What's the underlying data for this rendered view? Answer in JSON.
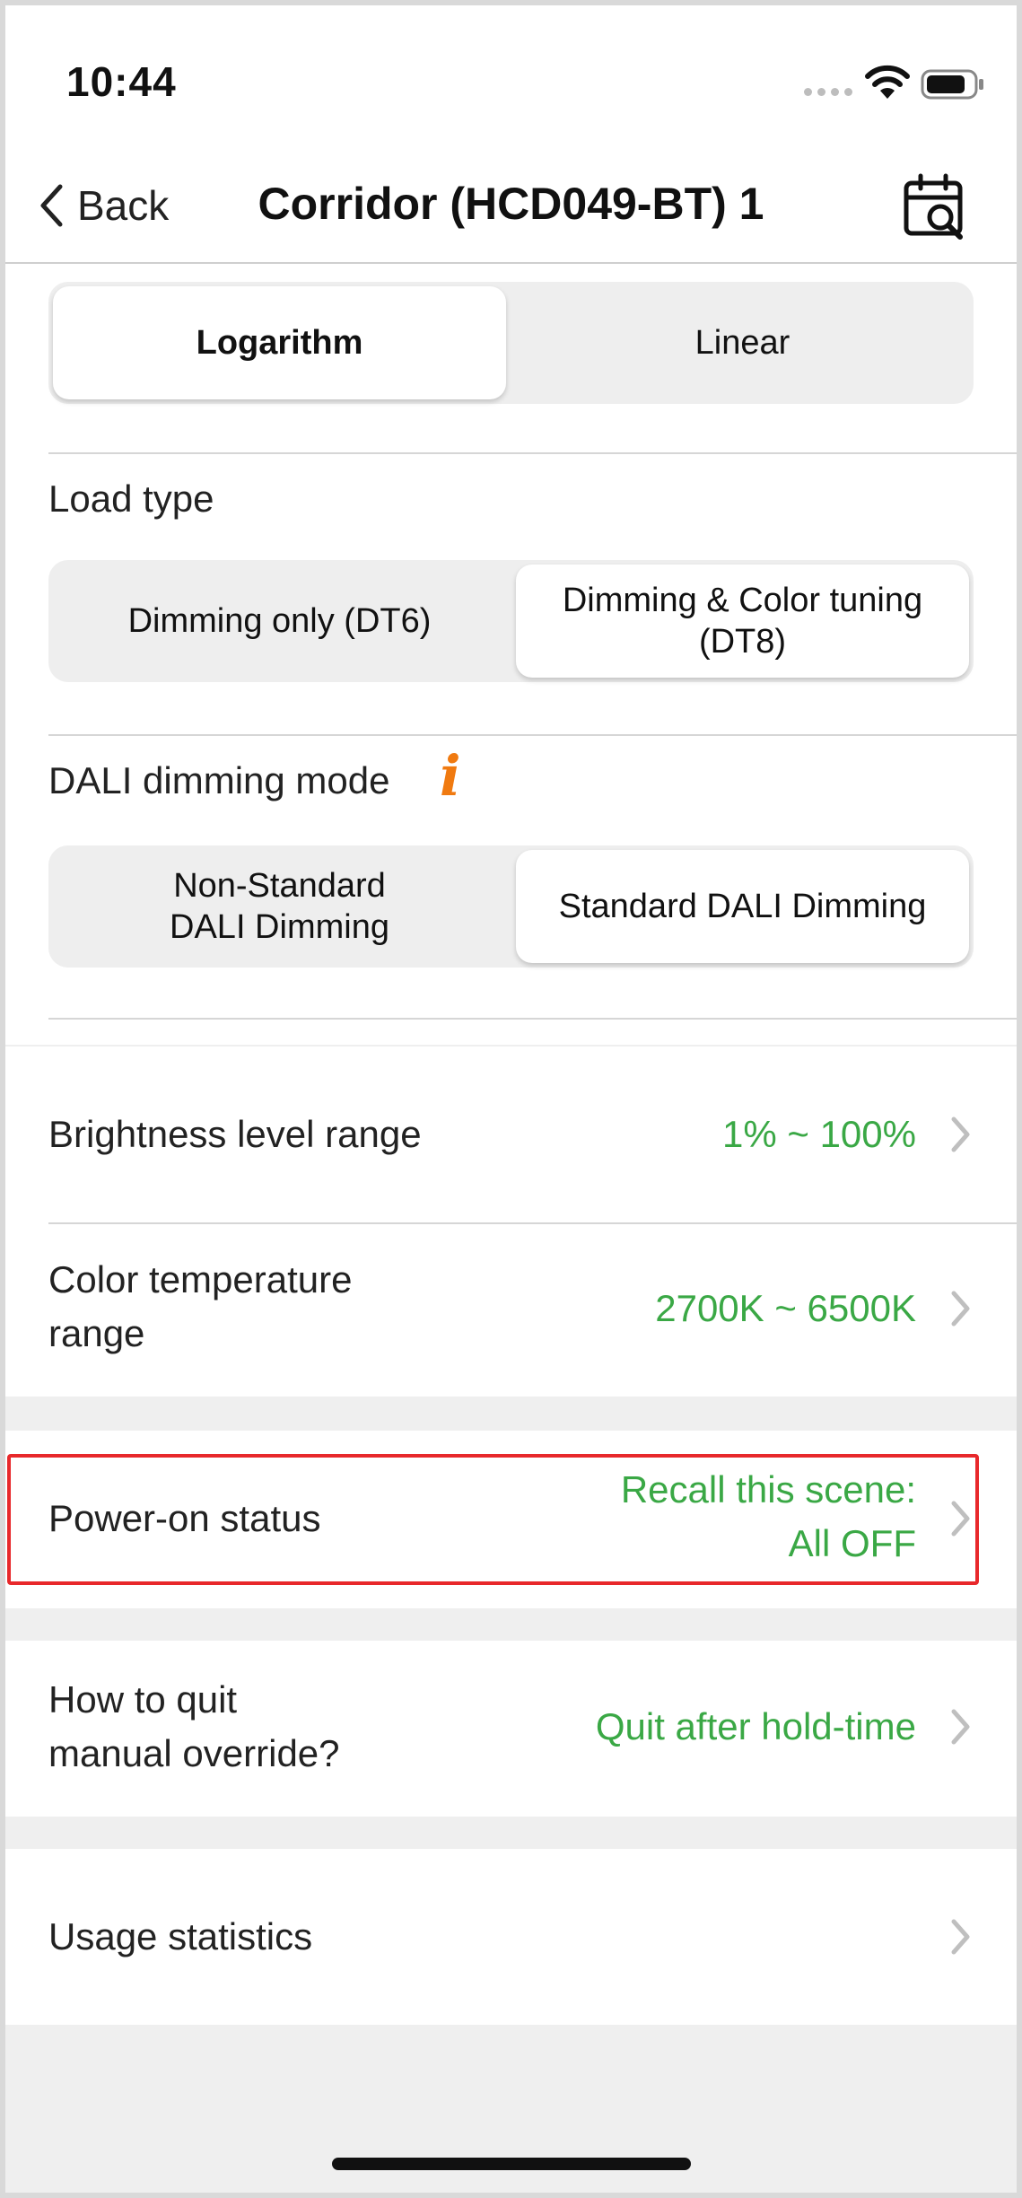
{
  "status": {
    "time": "10:44"
  },
  "nav": {
    "back": "Back",
    "title": "Corridor (HCD049-BT) 1"
  },
  "curve": {
    "options": [
      "Logarithm",
      "Linear"
    ],
    "selected": "Logarithm"
  },
  "load_type": {
    "label": "Load type",
    "options": [
      "Dimming only (DT6)",
      "Dimming & Color tuning\n(DT8)"
    ],
    "selected": "Dimming & Color tuning (DT8)"
  },
  "dali_mode": {
    "label": "DALI dimming mode",
    "info_glyph": "i",
    "options": [
      "Non-Standard\nDALI Dimming",
      "Standard DALI Dimming"
    ],
    "selected": "Standard DALI Dimming"
  },
  "settings": {
    "brightness": {
      "label": "Brightness level range",
      "value": "1% ~ 100%"
    },
    "color_temp": {
      "label": "Color temperature\nrange",
      "value": "2700K ~ 6500K"
    },
    "power_on": {
      "label": "Power-on status",
      "value": "Recall this scene:\nAll OFF"
    },
    "quit_override": {
      "label": "How to quit\nmanual override?",
      "value": "Quit after hold-time"
    },
    "usage": {
      "label": "Usage statistics"
    }
  },
  "colors": {
    "accent_green": "#3aa845",
    "info_orange": "#f07a10",
    "highlight_red": "#e8282b"
  }
}
